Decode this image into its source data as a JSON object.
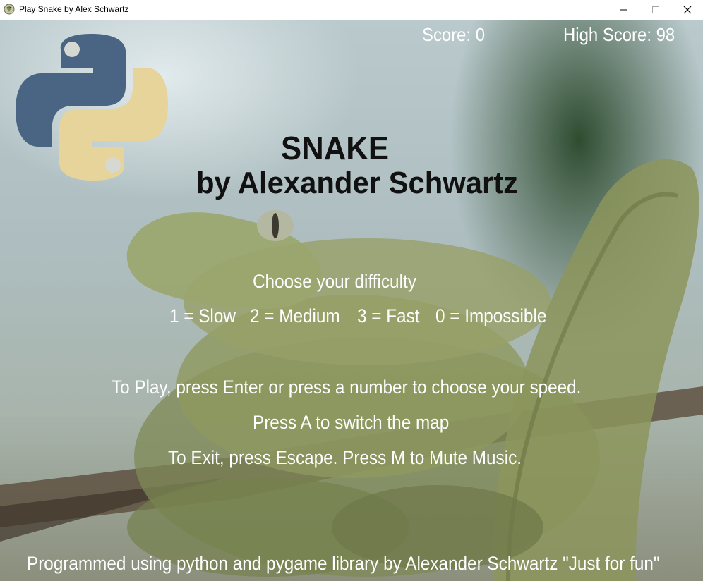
{
  "window": {
    "title": "Play Snake by Alex Schwartz",
    "controls": [
      "minimize",
      "maximize",
      "close"
    ]
  },
  "hud": {
    "score": "Score: 0",
    "high_score": "High Score: 98"
  },
  "title": {
    "line1": "SNAKE",
    "line2": "by Alexander Schwartz"
  },
  "menu": {
    "difficulty_prompt": "Choose your difficulty",
    "difficulties": [
      "1 = Slow",
      "2 = Medium",
      "3 = Fast",
      "0 = Impossible"
    ],
    "play_instruction": "To Play, press Enter or press a number to choose your speed.",
    "map_instruction": "Press A to switch the map",
    "exit_instruction": "To Exit, press Escape. Press M to Mute Music."
  },
  "footer": "Programmed using python and pygame library by Alexander Schwartz \"Just for fun\"",
  "icons": {
    "logo": "python-logo-icon",
    "app": "pygame-snake-app-icon",
    "background": "green-python-snake-photo"
  },
  "colors": {
    "text_light": "#ffffff",
    "title_text": "#111111",
    "python_blue": "#4a6484",
    "python_yellow": "#e6d49a"
  }
}
